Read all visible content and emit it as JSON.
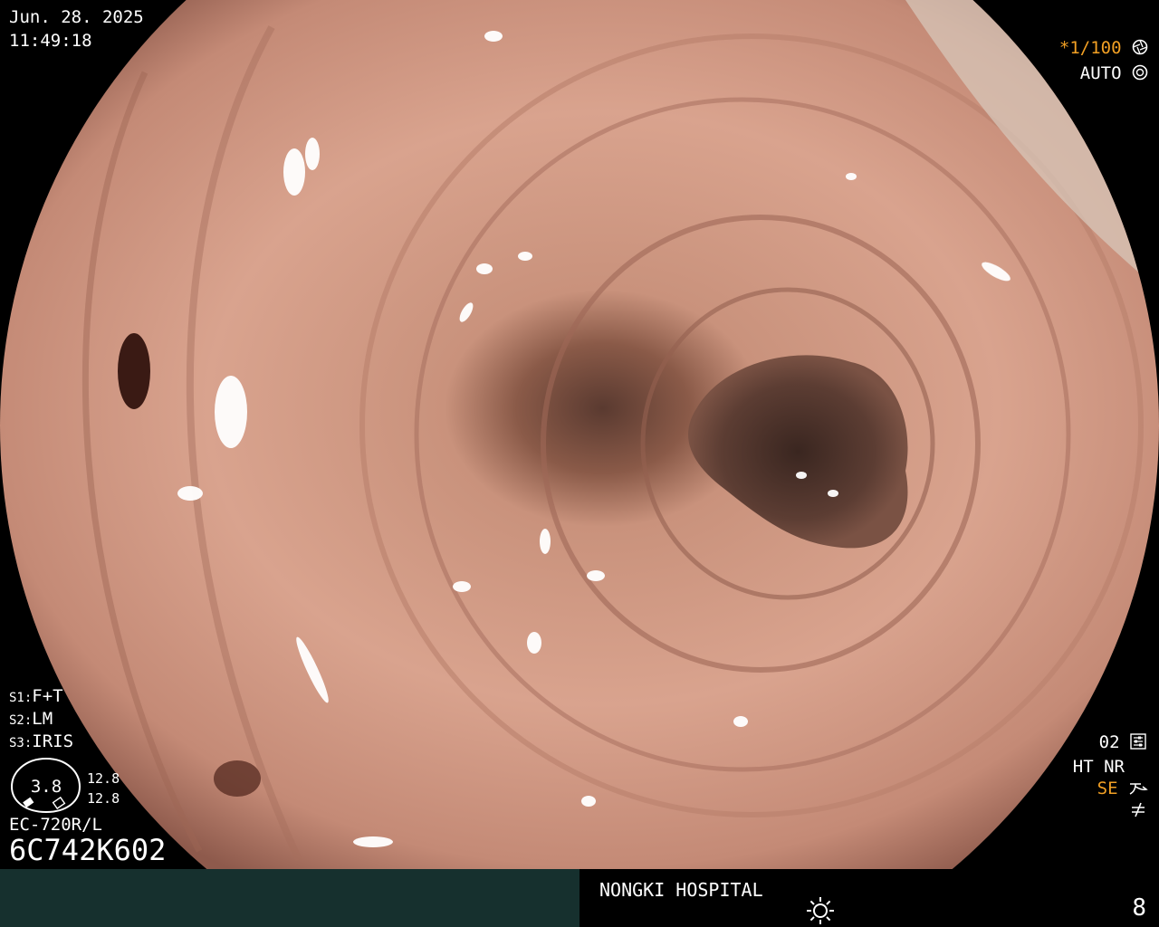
{
  "overlay": {
    "date": "Jun. 28. 2025",
    "time": "11:49:18",
    "shutter": "*1/100",
    "shutter_icon": "aperture-icon",
    "mode": "AUTO",
    "mode_icon": "iris-icon",
    "s1_prefix": "S1:",
    "s1_value": "F+T",
    "s2_prefix": "S2:",
    "s2_value": "LM",
    "s3_prefix": "S3:",
    "s3_value": "IRIS",
    "gauge_value": "3.8",
    "gauge_top": "12.8",
    "gauge_bottom": "12.8",
    "model": "EC-720R/L",
    "serial": "6C742K602",
    "o2": "02",
    "ht_nr": "HT NR",
    "se": "SE",
    "hospital": "NONGKI HOSPITAL",
    "page": "8"
  },
  "colors": {
    "accent_orange": "#f2a024",
    "bar_left": "#16302e",
    "tissue": "#c98e7c"
  }
}
